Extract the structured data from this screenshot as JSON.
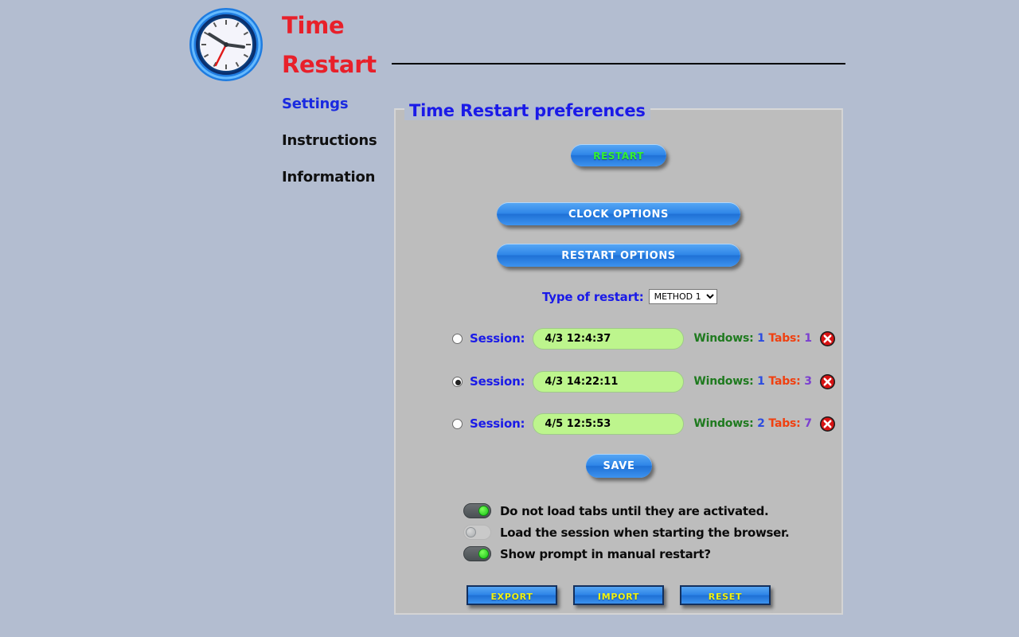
{
  "app": {
    "title_line1": "Time",
    "title_line2": "Restart",
    "icon": "clock-icon",
    "title_color": "#e8202a"
  },
  "nav": {
    "items": [
      {
        "label": "Settings",
        "active": true
      },
      {
        "label": "Instructions",
        "active": false
      },
      {
        "label": "Information",
        "active": false
      }
    ]
  },
  "panel": {
    "legend": "Time Restart preferences",
    "legend_color": "#1a1ae8",
    "restart_button": "RESTART",
    "restart_button_text_color": "#33f033",
    "clock_options_button": "CLOCK OPTIONS",
    "restart_options_button": "RESTART OPTIONS",
    "save_button": "SAVE"
  },
  "restart_type": {
    "label": "Type of restart:",
    "selected": "METHOD 1",
    "options": [
      "METHOD 1"
    ]
  },
  "sessions": {
    "label": "Session:",
    "windows_label": "Windows:",
    "tabs_label": "Tabs:",
    "delete_icon": "delete-circle-icon",
    "rows": [
      {
        "value": "4/3 12:4:37",
        "selected": false,
        "windows": "1",
        "tabs": "1"
      },
      {
        "value": "4/3 14:22:11",
        "selected": true,
        "windows": "1",
        "tabs": "3"
      },
      {
        "value": "4/5 12:5:53",
        "selected": false,
        "windows": "2",
        "tabs": "7"
      }
    ]
  },
  "toggles": [
    {
      "label": "Do not load tabs until they are activated.",
      "on": true
    },
    {
      "label": "Load the session when starting the browser.",
      "on": false
    },
    {
      "label": "Show prompt in manual restart?",
      "on": true
    }
  ],
  "bottom_buttons": {
    "export": "EXPORT",
    "import": "IMPORT",
    "reset": "RESET",
    "text_color": "#f2f211"
  }
}
